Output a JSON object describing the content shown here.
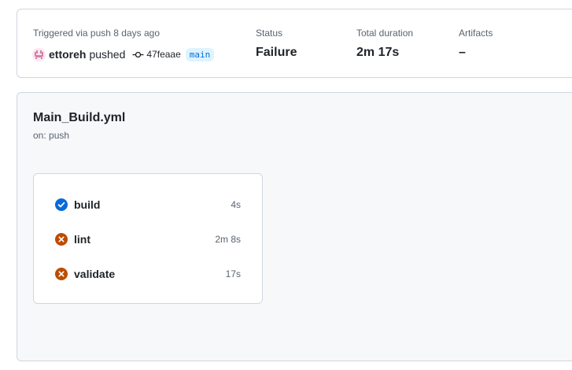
{
  "summary": {
    "trigger_text": "Triggered via push 8 days ago",
    "actor": "ettoreh",
    "action": "pushed",
    "commit_sha": "47feaae",
    "branch": "main",
    "status_label": "Status",
    "status_value": "Failure",
    "duration_label": "Total duration",
    "duration_value": "2m 17s",
    "artifacts_label": "Artifacts",
    "artifacts_value": "–"
  },
  "workflow": {
    "name": "Main_Build.yml",
    "trigger": "on: push",
    "jobs": [
      {
        "name": "build",
        "status": "success",
        "duration": "4s",
        "icon": "check-circle-fill-icon"
      },
      {
        "name": "lint",
        "status": "failure",
        "duration": "2m 8s",
        "icon": "x-circle-fill-icon"
      },
      {
        "name": "validate",
        "status": "failure",
        "duration": "17s",
        "icon": "x-circle-fill-icon"
      }
    ]
  },
  "colors": {
    "success": "#0969da",
    "failure": "#bc4c00",
    "branch_bg": "#ddf4ff",
    "branch_fg": "#0969da",
    "border": "#d0d7de",
    "panel_bg": "#f6f8fa",
    "muted_text": "#59636e"
  }
}
